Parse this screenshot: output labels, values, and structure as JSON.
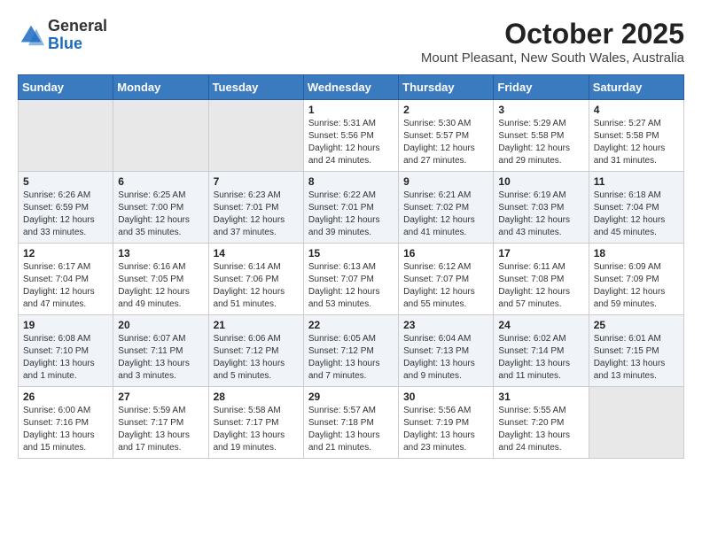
{
  "header": {
    "logo": {
      "line1": "General",
      "line2": "Blue"
    },
    "title": "October 2025",
    "subtitle": "Mount Pleasant, New South Wales, Australia"
  },
  "weekdays": [
    "Sunday",
    "Monday",
    "Tuesday",
    "Wednesday",
    "Thursday",
    "Friday",
    "Saturday"
  ],
  "weeks": [
    [
      {
        "day": null,
        "info": null
      },
      {
        "day": null,
        "info": null
      },
      {
        "day": null,
        "info": null
      },
      {
        "day": "1",
        "info": "Sunrise: 5:31 AM\nSunset: 5:56 PM\nDaylight: 12 hours\nand 24 minutes."
      },
      {
        "day": "2",
        "info": "Sunrise: 5:30 AM\nSunset: 5:57 PM\nDaylight: 12 hours\nand 27 minutes."
      },
      {
        "day": "3",
        "info": "Sunrise: 5:29 AM\nSunset: 5:58 PM\nDaylight: 12 hours\nand 29 minutes."
      },
      {
        "day": "4",
        "info": "Sunrise: 5:27 AM\nSunset: 5:58 PM\nDaylight: 12 hours\nand 31 minutes."
      }
    ],
    [
      {
        "day": "5",
        "info": "Sunrise: 6:26 AM\nSunset: 6:59 PM\nDaylight: 12 hours\nand 33 minutes."
      },
      {
        "day": "6",
        "info": "Sunrise: 6:25 AM\nSunset: 7:00 PM\nDaylight: 12 hours\nand 35 minutes."
      },
      {
        "day": "7",
        "info": "Sunrise: 6:23 AM\nSunset: 7:01 PM\nDaylight: 12 hours\nand 37 minutes."
      },
      {
        "day": "8",
        "info": "Sunrise: 6:22 AM\nSunset: 7:01 PM\nDaylight: 12 hours\nand 39 minutes."
      },
      {
        "day": "9",
        "info": "Sunrise: 6:21 AM\nSunset: 7:02 PM\nDaylight: 12 hours\nand 41 minutes."
      },
      {
        "day": "10",
        "info": "Sunrise: 6:19 AM\nSunset: 7:03 PM\nDaylight: 12 hours\nand 43 minutes."
      },
      {
        "day": "11",
        "info": "Sunrise: 6:18 AM\nSunset: 7:04 PM\nDaylight: 12 hours\nand 45 minutes."
      }
    ],
    [
      {
        "day": "12",
        "info": "Sunrise: 6:17 AM\nSunset: 7:04 PM\nDaylight: 12 hours\nand 47 minutes."
      },
      {
        "day": "13",
        "info": "Sunrise: 6:16 AM\nSunset: 7:05 PM\nDaylight: 12 hours\nand 49 minutes."
      },
      {
        "day": "14",
        "info": "Sunrise: 6:14 AM\nSunset: 7:06 PM\nDaylight: 12 hours\nand 51 minutes."
      },
      {
        "day": "15",
        "info": "Sunrise: 6:13 AM\nSunset: 7:07 PM\nDaylight: 12 hours\nand 53 minutes."
      },
      {
        "day": "16",
        "info": "Sunrise: 6:12 AM\nSunset: 7:07 PM\nDaylight: 12 hours\nand 55 minutes."
      },
      {
        "day": "17",
        "info": "Sunrise: 6:11 AM\nSunset: 7:08 PM\nDaylight: 12 hours\nand 57 minutes."
      },
      {
        "day": "18",
        "info": "Sunrise: 6:09 AM\nSunset: 7:09 PM\nDaylight: 12 hours\nand 59 minutes."
      }
    ],
    [
      {
        "day": "19",
        "info": "Sunrise: 6:08 AM\nSunset: 7:10 PM\nDaylight: 13 hours\nand 1 minute."
      },
      {
        "day": "20",
        "info": "Sunrise: 6:07 AM\nSunset: 7:11 PM\nDaylight: 13 hours\nand 3 minutes."
      },
      {
        "day": "21",
        "info": "Sunrise: 6:06 AM\nSunset: 7:12 PM\nDaylight: 13 hours\nand 5 minutes."
      },
      {
        "day": "22",
        "info": "Sunrise: 6:05 AM\nSunset: 7:12 PM\nDaylight: 13 hours\nand 7 minutes."
      },
      {
        "day": "23",
        "info": "Sunrise: 6:04 AM\nSunset: 7:13 PM\nDaylight: 13 hours\nand 9 minutes."
      },
      {
        "day": "24",
        "info": "Sunrise: 6:02 AM\nSunset: 7:14 PM\nDaylight: 13 hours\nand 11 minutes."
      },
      {
        "day": "25",
        "info": "Sunrise: 6:01 AM\nSunset: 7:15 PM\nDaylight: 13 hours\nand 13 minutes."
      }
    ],
    [
      {
        "day": "26",
        "info": "Sunrise: 6:00 AM\nSunset: 7:16 PM\nDaylight: 13 hours\nand 15 minutes."
      },
      {
        "day": "27",
        "info": "Sunrise: 5:59 AM\nSunset: 7:17 PM\nDaylight: 13 hours\nand 17 minutes."
      },
      {
        "day": "28",
        "info": "Sunrise: 5:58 AM\nSunset: 7:17 PM\nDaylight: 13 hours\nand 19 minutes."
      },
      {
        "day": "29",
        "info": "Sunrise: 5:57 AM\nSunset: 7:18 PM\nDaylight: 13 hours\nand 21 minutes."
      },
      {
        "day": "30",
        "info": "Sunrise: 5:56 AM\nSunset: 7:19 PM\nDaylight: 13 hours\nand 23 minutes."
      },
      {
        "day": "31",
        "info": "Sunrise: 5:55 AM\nSunset: 7:20 PM\nDaylight: 13 hours\nand 24 minutes."
      },
      {
        "day": null,
        "info": null
      }
    ]
  ]
}
